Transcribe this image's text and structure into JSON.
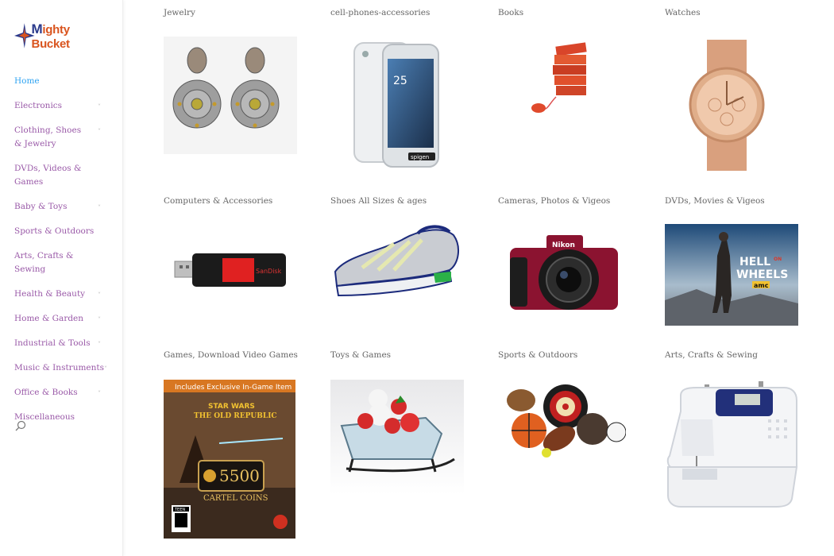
{
  "logo": {
    "text_m": "M",
    "text_rest": "ighty Bucket"
  },
  "nav": {
    "items": [
      {
        "label": "Home",
        "has_children": false,
        "active": true
      },
      {
        "label": "Electronics",
        "has_children": true
      },
      {
        "label": "Clothing, Shoes & Jewelry",
        "has_children": true
      },
      {
        "label": "DVDs, Videos & Games",
        "has_children": false
      },
      {
        "label": "Baby & Toys",
        "has_children": true
      },
      {
        "label": "Sports & Outdoors",
        "has_children": false
      },
      {
        "label": "Arts, Crafts & Sewing",
        "has_children": false
      },
      {
        "label": "Health & Beauty",
        "has_children": true
      },
      {
        "label": "Home & Garden",
        "has_children": true
      },
      {
        "label": "Industrial & Tools",
        "has_children": true
      },
      {
        "label": "Music & Instruments",
        "has_children": true
      },
      {
        "label": "Office & Books",
        "has_children": true
      },
      {
        "label": "Miscellaneous",
        "has_children": false
      }
    ],
    "chevron": "˅",
    "search_icon": "search-icon"
  },
  "categories": [
    {
      "label": "Jewelry",
      "icon": "earrings"
    },
    {
      "label": "cell-phones-accessories",
      "icon": "phone"
    },
    {
      "label": "Books",
      "icon": "books"
    },
    {
      "label": "Watches",
      "icon": "watch"
    },
    {
      "label": "Computers & Accessories",
      "icon": "usb-drive"
    },
    {
      "label": "Shoes All Sizes & ages",
      "icon": "sneaker"
    },
    {
      "label": "Cameras, Photos & Vigeos",
      "icon": "camera"
    },
    {
      "label": "DVDs, Movies & Vigeos",
      "icon": "hell-on-wheels-poster"
    },
    {
      "label": "Games, Download Video Games",
      "icon": "game-card"
    },
    {
      "label": "Toys & Games",
      "icon": "sleigh-toys"
    },
    {
      "label": "Sports & Outdoors",
      "icon": "sports-balls"
    },
    {
      "label": "Arts, Crafts & Sewing",
      "icon": "sewing-machine"
    }
  ],
  "artwork": {
    "usb_brand": "SanDisk",
    "phone_brand": "spigen",
    "camera_brand": "Nikon",
    "poster_title_1": "HELL",
    "poster_title_on": "ON",
    "poster_title_2": "WHEELS",
    "poster_network": "amc",
    "game_banner": "Includes Exclusive In-Game Item",
    "game_title_1": "STAR WARS",
    "game_title_2": "THE OLD REPUBLIC",
    "game_coins": "5500",
    "game_coins_label": "CARTEL COINS",
    "game_rating": "TEEN"
  },
  "colors": {
    "nav_link": "#9a5aa8",
    "nav_active": "#2ea3f2",
    "logo_orange": "#d9541e",
    "logo_blue": "#2a3a8c"
  }
}
